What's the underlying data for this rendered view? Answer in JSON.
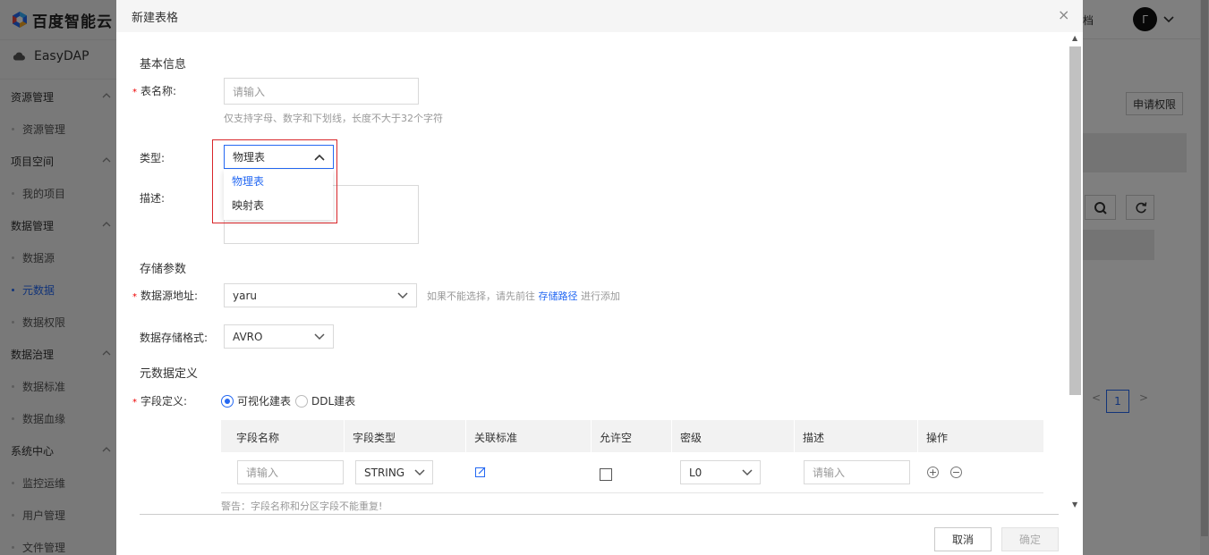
{
  "app": {
    "brand": "百度智能云",
    "product": "EasyDAP"
  },
  "sidebar": {
    "groups": [
      {
        "label": "资源管理",
        "items": [
          "资源管理"
        ]
      },
      {
        "label": "项目空间",
        "items": [
          "我的项目"
        ]
      },
      {
        "label": "数据管理",
        "items": [
          "数据源",
          "元数据",
          "数据权限"
        ]
      },
      {
        "label": "数据治理",
        "items": [
          "数据标准",
          "数据血缘"
        ]
      },
      {
        "label": "系统中心",
        "items": [
          "监控运维",
          "用户管理",
          "文件管理"
        ]
      }
    ],
    "active_item": "元数据"
  },
  "topbar": {
    "partial_text": "档",
    "avatar_letter": "Γ"
  },
  "background": {
    "apply_button": "申请权限",
    "pager": {
      "prev": "<",
      "current": "1",
      "next": ">"
    }
  },
  "modal": {
    "title": "新建表格",
    "close": "×",
    "basic_section": "基本信息",
    "table_name": {
      "label": "表名称:",
      "placeholder": "请输入",
      "hint": "仅支持字母、数字和下划线，长度不大于32个字符"
    },
    "type": {
      "label": "类型:",
      "value": "物理表",
      "options": [
        "物理表",
        "映射表"
      ]
    },
    "description": {
      "label": "描述:"
    },
    "storage_section": "存储参数",
    "datasource": {
      "label": "数据源地址:",
      "value": "yaru",
      "hint_prefix": "如果不能选择，请先前往",
      "hint_link": "存储路径",
      "hint_suffix": "进行添加"
    },
    "storage_format": {
      "label": "数据存储格式:",
      "value": "AVRO"
    },
    "metadata_section": "元数据定义",
    "field_def": {
      "label": "字段定义:",
      "radio_visual": "可视化建表",
      "radio_ddl": "DDL建表"
    },
    "table": {
      "headers": [
        "字段名称",
        "字段类型",
        "关联标准",
        "允许空",
        "密级",
        "描述",
        "操作"
      ],
      "row": {
        "name_placeholder": "请输入",
        "type_value": "STRING",
        "level_value": "L0",
        "desc_placeholder": "请输入"
      }
    },
    "warning": "警告：字段名称和分区字段不能重复!",
    "cancel": "取消",
    "confirm": "确定"
  },
  "colors": {
    "accent": "#2468f2",
    "highlight_box": "#d9262a",
    "required": "#ee0000"
  }
}
